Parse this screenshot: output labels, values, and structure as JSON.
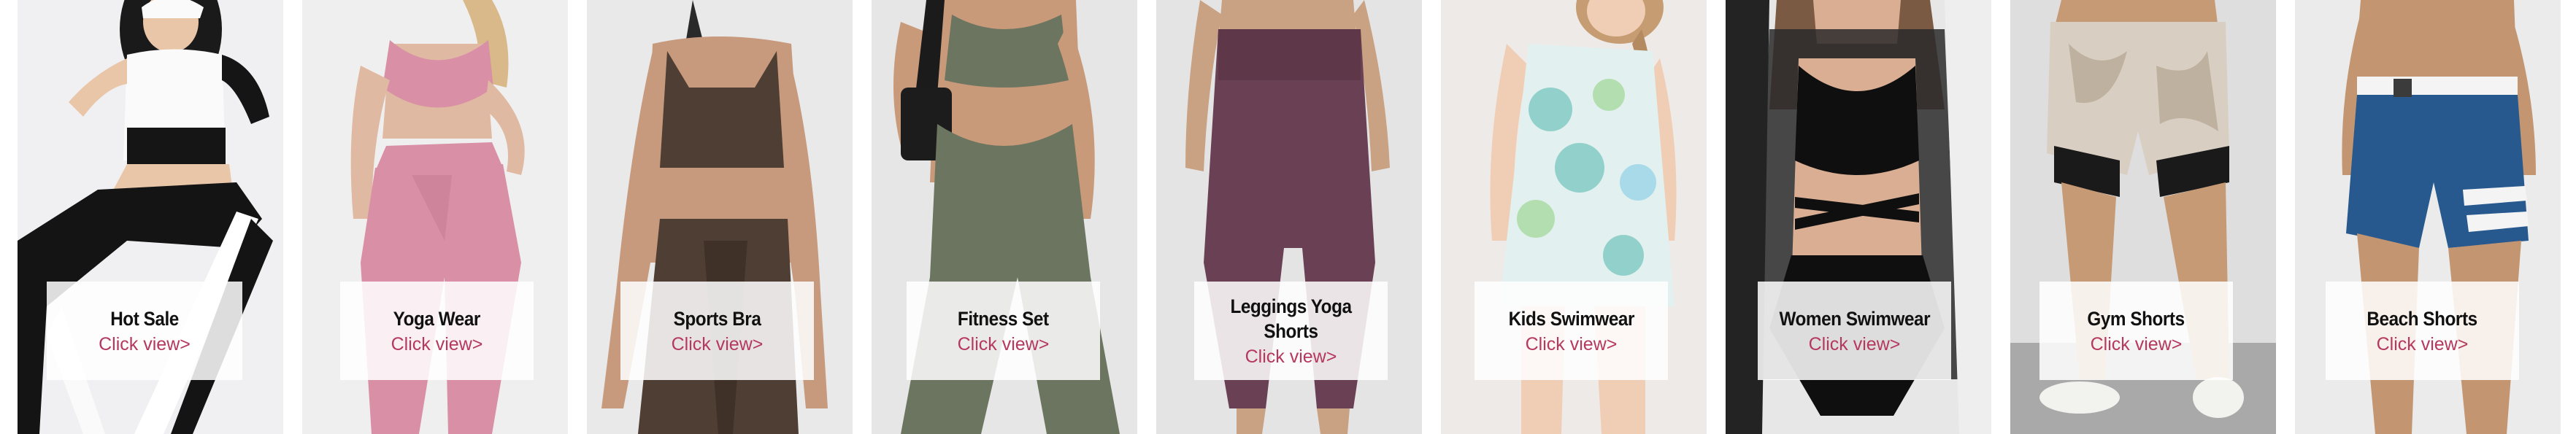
{
  "colors": {
    "link": "#b5385f",
    "title": "#111111"
  },
  "categories": [
    {
      "title": "Hot Sale",
      "link": "Click view>"
    },
    {
      "title": "Yoga Wear",
      "link": "Click view>"
    },
    {
      "title": "Sports Bra",
      "link": "Click view>"
    },
    {
      "title": "Fitness Set",
      "link": "Click view>"
    },
    {
      "title": "Leggings Yoga Shorts",
      "link": "Click view>"
    },
    {
      "title": "Kids Swimwear",
      "link": "Click view>"
    },
    {
      "title": "Women Swimwear",
      "link": "Click view>"
    },
    {
      "title": "Gym Shorts",
      "link": "Click view>"
    },
    {
      "title": "Beach Shorts",
      "link": "Click view>"
    }
  ]
}
